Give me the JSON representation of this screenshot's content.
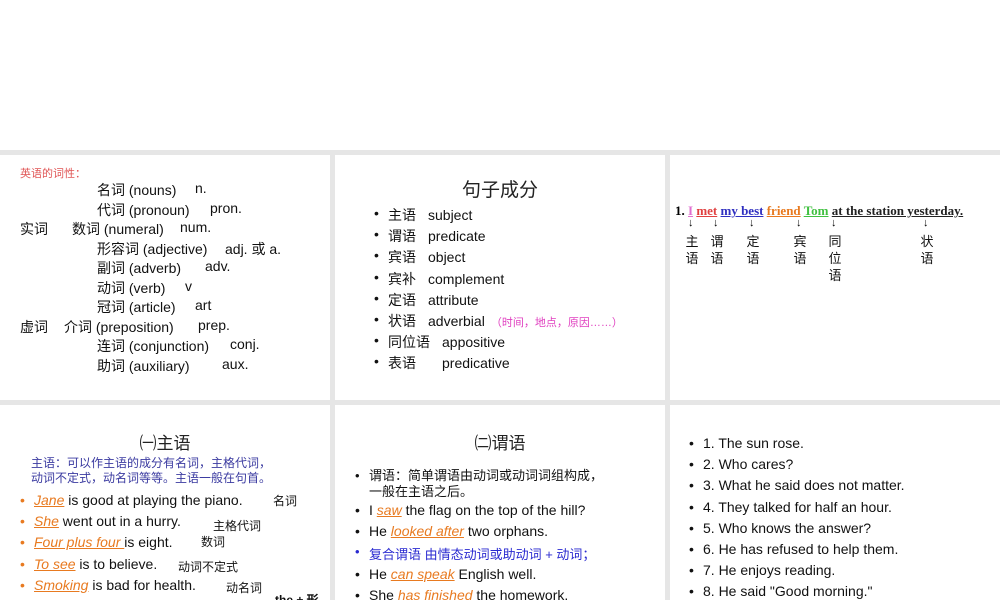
{
  "slide1": {
    "heading": "英语的词性：",
    "rows": [
      {
        "group": "",
        "item": "名词 (nouns)",
        "abbr": "n."
      },
      {
        "group": "",
        "item": "代词 (pronoun)",
        "abbr": "pron."
      },
      {
        "group": "实词",
        "item": "数词 (numeral)",
        "abbr": "num."
      },
      {
        "group": "",
        "item": "形容词 (adjective)",
        "abbr": "adj.  或 a."
      },
      {
        "group": "",
        "item": "副词 (adverb)",
        "abbr": "adv."
      },
      {
        "group": "",
        "item": "动词 (verb)",
        "abbr": "v"
      },
      {
        "group": "",
        "item": "冠词 (article)",
        "abbr": "art"
      },
      {
        "group": "虚词",
        "item": "介词 (preposition)",
        "abbr": "prep."
      },
      {
        "group": "",
        "item": "连词 (conjunction)",
        "abbr": "conj."
      },
      {
        "group": "",
        "item": "助词 (auxiliary)",
        "abbr": "aux."
      }
    ]
  },
  "slide2": {
    "title": "句子成分",
    "items": [
      {
        "cn": "主语",
        "en": "subject"
      },
      {
        "cn": "谓语",
        "en": "predicate"
      },
      {
        "cn": "宾语",
        "en": "object"
      },
      {
        "cn": "宾补",
        "en": "complement"
      },
      {
        "cn": "定语",
        "en": "attribute"
      },
      {
        "cn": "状语",
        "en": "adverbial",
        "note": "（时间，地点，原因……）"
      },
      {
        "cn": "同位语",
        "en": "appositive"
      },
      {
        "cn": "表语",
        "en": "predicative"
      }
    ]
  },
  "slide3": {
    "number": "1.",
    "words": [
      "I",
      "met",
      "my best",
      "friend",
      "Tom",
      "at the station yesterday."
    ],
    "labels": [
      "主语",
      "谓语",
      "定语",
      "宾语",
      "同位语",
      "状语"
    ],
    "arrow": "↓"
  },
  "slide4": {
    "title": "㈠主语",
    "desc1": "主语：可以作主语的成分有名词，主格代词，",
    "desc2": "动词不定式，动名词等等。主语一般在句首。",
    "items": [
      {
        "hl": "Jane",
        "rest": " is good at playing the piano.",
        "note": "名词"
      },
      {
        "hl": "She",
        "rest": " went out in a hurry.",
        "note": "主格代词"
      },
      {
        "hl": "Four plus four ",
        "rest": "is eight.",
        "note": "数词"
      },
      {
        "hl": "To see",
        "rest": " is to believe.",
        "note": "动词不定式"
      },
      {
        "hl": "Smoking",
        "rest": " is bad for health.",
        "note": "动名词"
      }
    ],
    "cut_note": "the + 形"
  },
  "slide5": {
    "title": "㈡谓语",
    "desc1": "谓语：简单谓语由动词或动词词组构成，",
    "desc2": "一般在主语之后。",
    "ex1": {
      "pre": "I ",
      "hl": "saw",
      "rest": " the flag on the top of the hill?"
    },
    "ex2": {
      "pre": "He ",
      "hl": "looked after",
      "rest": " two orphans."
    },
    "compound": "复合谓语  由情态动词或助动词 + 动词；",
    "ex3": {
      "pre": "He ",
      "hl": "can speak",
      "rest": " English well."
    },
    "ex4": {
      "pre": "She ",
      "hl": "has finished",
      "rest": " the homework."
    }
  },
  "slide6": {
    "items": [
      "1. The sun rose.",
      "2. Who cares?",
      "3. What he said does not matter.",
      "4. They talked for half an hour.",
      "5. Who knows the answer?",
      "6. He has refused to help them.",
      "7. He enjoys reading.",
      "8. He said \"Good morning.\""
    ]
  }
}
